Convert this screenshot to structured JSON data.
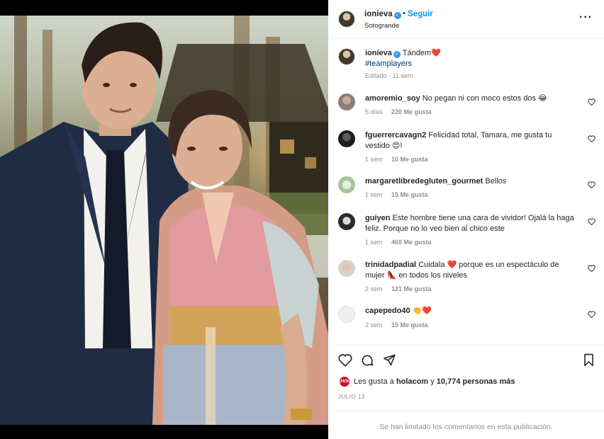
{
  "post": {
    "author": "ionieva",
    "follow_label": "Seguir",
    "dot": "•",
    "location": "Sotogrande",
    "more_icon": "more-horizontal-icon",
    "caption_user": "ionieva",
    "caption_text": "Tándem",
    "caption_hashtag": "#teamplayers",
    "caption_meta": "Editado · 11 sem"
  },
  "comments": [
    {
      "user": "amoremio_soy",
      "text": "No pegan ni con moco estos dos 😂",
      "time": "5 días",
      "likes": "220 Me gusta"
    },
    {
      "user": "fguerrercavagn2",
      "text": "Felicidad total, Tamara, me gusta tu vestido 😍!",
      "time": "1 sem",
      "likes": "10 Me gusta"
    },
    {
      "user": "margaretlibredegluten_gourmet",
      "text": "Bellos",
      "time": "1 sem",
      "likes": "15 Me gusta"
    },
    {
      "user": "guiyen",
      "text": "Este hombre tiene una cara de vividor! Ojalá la haga feliz. Porque no lo veo bien al chico este",
      "time": "1 sem",
      "likes": "460 Me gusta"
    },
    {
      "user": "trinidadpadial",
      "text": "Cuidala ❤️ porque es un espectáculo de mujer 👠 en todos los niveles",
      "time": "2 sem",
      "likes": "121 Me gusta"
    },
    {
      "user": "capepedo40",
      "text": "👏❤️",
      "time": "2 sem",
      "likes": "15 Me gusta"
    }
  ],
  "actions": {
    "liked_prefix": "Les gusta a",
    "liked_user": "holacom",
    "liked_and": "y",
    "liked_count": "10,774 personas más",
    "liked_avatar_text": "¡HOLA!",
    "date": "JULIO 13"
  },
  "footer": {
    "limited_text": "Se han limitado los comentarios en esta publicación."
  },
  "colors": {
    "accent": "#0095f6",
    "heart": "#ed4956",
    "verified": "#3897f0"
  }
}
